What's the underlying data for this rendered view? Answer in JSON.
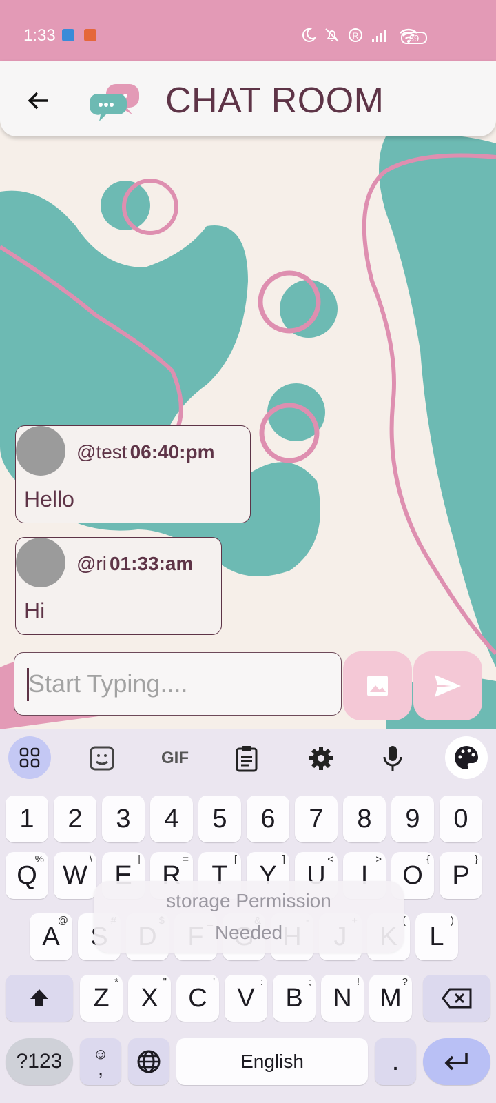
{
  "status_bar": {
    "time": "1:33",
    "battery": "39"
  },
  "app_bar": {
    "title": "CHAT ROOM"
  },
  "messages": [
    {
      "user": "@test",
      "time": "06:40:pm",
      "text": "Hello"
    },
    {
      "user": "@ri",
      "time": "01:33:am",
      "text": "Hi"
    }
  ],
  "composer": {
    "placeholder": "Start Typing...."
  },
  "keyboard": {
    "toolbar": [
      "apps-grid-icon",
      "sticker-icon",
      "GIF",
      "clipboard-icon",
      "gear-icon",
      "mic-icon",
      "palette-icon"
    ],
    "gif_label": "GIF",
    "row_numbers": [
      "1",
      "2",
      "3",
      "4",
      "5",
      "6",
      "7",
      "8",
      "9",
      "0"
    ],
    "row_q": [
      {
        "k": "Q",
        "h": "%"
      },
      {
        "k": "W",
        "h": "\\"
      },
      {
        "k": "E",
        "h": "|"
      },
      {
        "k": "R",
        "h": "="
      },
      {
        "k": "T",
        "h": "["
      },
      {
        "k": "Y",
        "h": "]"
      },
      {
        "k": "U",
        "h": "<"
      },
      {
        "k": "I",
        "h": ">"
      },
      {
        "k": "O",
        "h": "{"
      },
      {
        "k": "P",
        "h": "}"
      }
    ],
    "row_a": [
      {
        "k": "A",
        "h": "@"
      },
      {
        "k": "S",
        "h": "#"
      },
      {
        "k": "D",
        "h": "$"
      },
      {
        "k": "F",
        "h": "_"
      },
      {
        "k": "G",
        "h": "&"
      },
      {
        "k": "H",
        "h": "-"
      },
      {
        "k": "J",
        "h": "+"
      },
      {
        "k": "K",
        "h": "("
      },
      {
        "k": "L",
        "h": ")"
      }
    ],
    "row_z": [
      {
        "k": "Z",
        "h": "*"
      },
      {
        "k": "X",
        "h": "\""
      },
      {
        "k": "C",
        "h": "'"
      },
      {
        "k": "V",
        "h": ":"
      },
      {
        "k": "B",
        "h": ";"
      },
      {
        "k": "N",
        "h": "!"
      },
      {
        "k": "M",
        "h": "?"
      }
    ],
    "symbols_label": "?123",
    "comma_label": ",",
    "space_label": "English",
    "period_label": "."
  },
  "toast": {
    "line1": "storage Permission",
    "line2": "Needed"
  },
  "colors": {
    "status_bar": "#e39ab6",
    "accent": "#5e3447",
    "teal": "#6dbab3",
    "pink_line": "#de8fb0"
  }
}
